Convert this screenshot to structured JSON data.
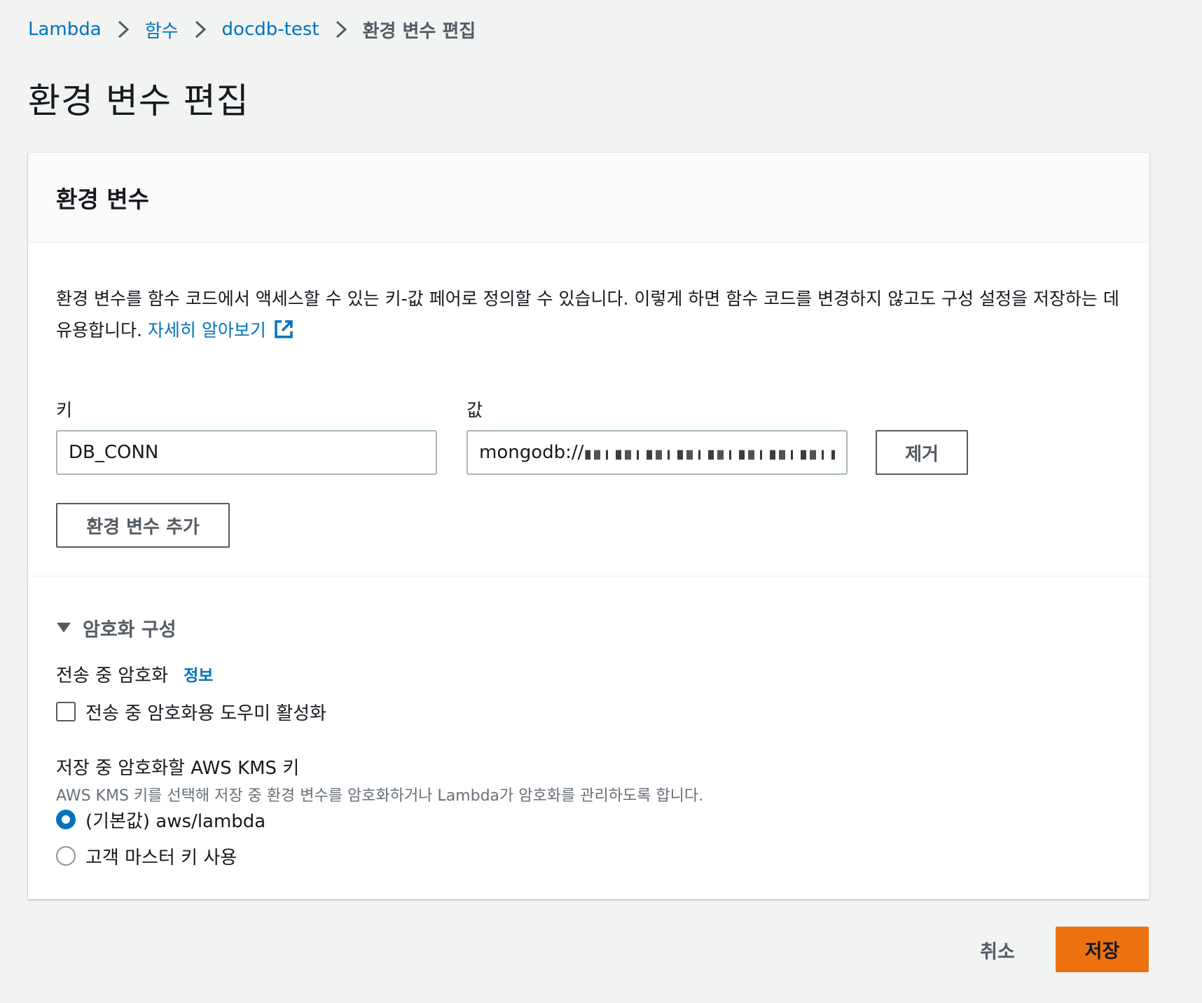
{
  "breadcrumb": {
    "items": [
      "Lambda",
      "함수",
      "docdb-test"
    ],
    "current": "환경 변수 편집"
  },
  "page": {
    "title": "환경 변수 편집"
  },
  "env_panel": {
    "title": "환경 변수",
    "description": "환경 변수를 함수 코드에서 액세스할 수 있는 키-값 페어로 정의할 수 있습니다. 이렇게 하면 함수 코드를 변경하지 않고도 구성 설정을 저장하는 데 유용합니다.",
    "learn_more": "자세히 알아보기",
    "key_label": "키",
    "value_label": "값",
    "key_value": "DB_CONN",
    "value_value": "mongodb://",
    "remove_label": "제거",
    "add_label": "환경 변수 추가"
  },
  "encryption": {
    "section_title": "암호화 구성",
    "transit_label": "전송 중 암호화",
    "info_label": "정보",
    "helper_checkbox_label": "전송 중 암호화용 도우미 활성화",
    "helper_checked": false,
    "kms_title": "저장 중 암호화할 AWS KMS 키",
    "kms_description": "AWS KMS 키를 선택해 저장 중 환경 변수를 암호화하거나 Lambda가 암호화를 관리하도록 합니다.",
    "options": [
      {
        "label": "(기본값) aws/lambda",
        "selected": true
      },
      {
        "label": "고객 마스터 키 사용",
        "selected": false
      }
    ]
  },
  "footer": {
    "cancel_label": "취소",
    "save_label": "저장"
  },
  "colors": {
    "link": "#0073bb",
    "primary_button": "#ec7211",
    "background": "#f2f3f3"
  },
  "icons": {
    "breadcrumb_separator": "chevron-right-icon",
    "external_link": "external-link-icon",
    "section_toggle": "caret-down-icon"
  }
}
